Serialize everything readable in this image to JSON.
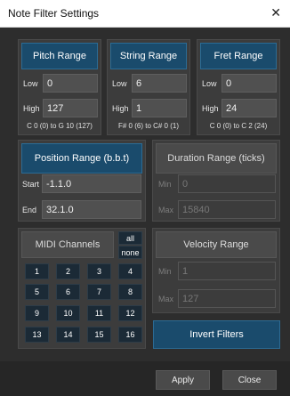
{
  "window": {
    "title": "Note Filter Settings",
    "close_glyph": "✕"
  },
  "pitch": {
    "header": "Pitch Range",
    "low_label": "Low",
    "low_value": "0",
    "high_label": "High",
    "high_value": "127",
    "note": "C 0 (0) to G 10 (127)"
  },
  "string": {
    "header": "String Range",
    "low_label": "Low",
    "low_value": "6",
    "high_label": "High",
    "high_value": "1",
    "note": "F# 0 (6) to C# 0 (1)"
  },
  "fret": {
    "header": "Fret Range",
    "low_label": "Low",
    "low_value": "0",
    "high_label": "High",
    "high_value": "24",
    "note": "C 0 (0) to C 2 (24)"
  },
  "position": {
    "header": "Position Range (b.b.t)",
    "start_label": "Start",
    "start_value": "-1.1.0",
    "end_label": "End",
    "end_value": "32.1.0"
  },
  "duration": {
    "header": "Duration Range (ticks)",
    "min_label": "Min",
    "min_value": "0",
    "max_label": "Max",
    "max_value": "15840"
  },
  "midi": {
    "header": "MIDI Channels",
    "all_label": "all",
    "none_label": "none",
    "channels": [
      "1",
      "2",
      "3",
      "4",
      "5",
      "6",
      "7",
      "8",
      "9",
      "10",
      "11",
      "12",
      "13",
      "14",
      "15",
      "16"
    ]
  },
  "velocity": {
    "header": "Velocity Range",
    "min_label": "Min",
    "min_value": "1",
    "max_label": "Max",
    "max_value": "127"
  },
  "invert_label": "Invert Filters",
  "footer": {
    "apply_label": "Apply",
    "close_label": "Close"
  },
  "colors": {
    "accent_blue": "#1a4b6c",
    "dark_bg": "#2d2d2d",
    "channel_bg": "#1b2a36"
  }
}
